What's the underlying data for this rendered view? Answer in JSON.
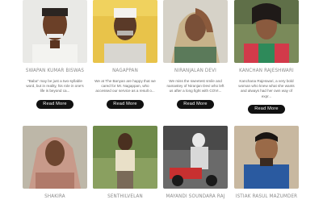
{
  "row1": [
    {
      "name": "SWAPAN KUMAR BISWAS",
      "desc": "\"Baba\" may be just a two-syllable word, but in reality, his role in one's life is beyond ca...",
      "button": "Read More"
    },
    {
      "name": "NAGAPPAN",
      "desc": "We at The Banyan are happy that we cared for Mr. Nagappan, who accessed our service as a result o...",
      "button": "Read More"
    },
    {
      "name": "NIRANJALAN DEVI",
      "desc": "We miss the sweetest smile and namastey of Niranjan Devi who left us after a long fight with COVI...",
      "button": "Read More"
    },
    {
      "name": "KANCHAN RAJESHWARI",
      "desc": "Kanchana Rajeswari, a very bold woman who knew what she wants and always had her own way of expr...",
      "button": "Read More"
    }
  ],
  "row2": [
    {
      "name": "SHAKIRA"
    },
    {
      "name": "SENTHILVELAN"
    },
    {
      "name": "MAYANDI SOUNDARA RAJ"
    },
    {
      "name": "ISTIAK RASUL MAZUMDER"
    }
  ]
}
